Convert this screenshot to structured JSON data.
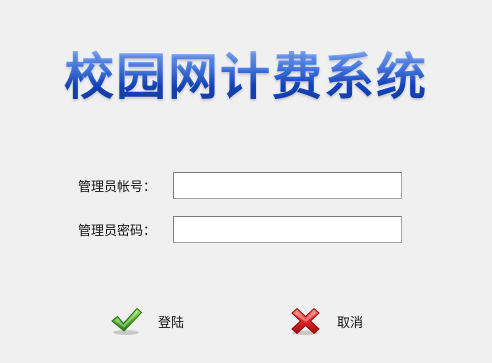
{
  "app": {
    "title": "校园网计费系统"
  },
  "login_form": {
    "account_label": "管理员帐号：",
    "account_value": "",
    "password_label": "管理员密码：",
    "password_value": ""
  },
  "actions": {
    "login_label": "登陆",
    "login_icon": "checkmark-icon",
    "cancel_label": "取消",
    "cancel_icon": "cross-icon"
  },
  "colors": {
    "background": "#f0f0f0",
    "title_blue": "#1f4fb8",
    "check_green": "#4caf2a",
    "cross_red": "#d8222a"
  }
}
